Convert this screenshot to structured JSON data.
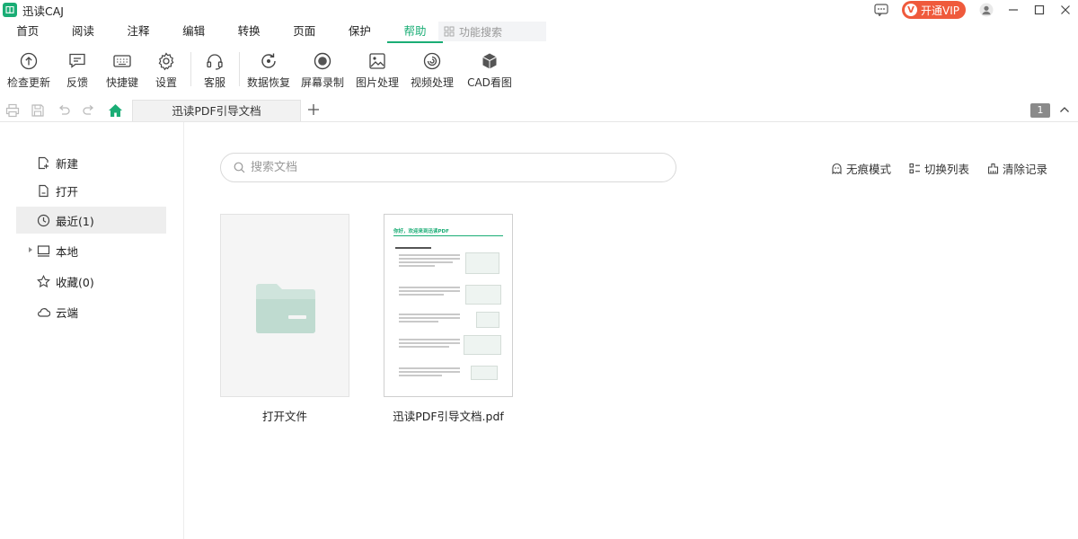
{
  "app": {
    "name": "迅读CAJ"
  },
  "titlebar": {
    "vip_label": "开通VIP",
    "vip_badge": "V"
  },
  "menu": {
    "tabs": [
      "首页",
      "阅读",
      "注释",
      "编辑",
      "转换",
      "页面",
      "保护",
      "帮助"
    ],
    "active_tab": "帮助",
    "search_placeholder": "功能搜索"
  },
  "ribbon": {
    "items": [
      "检查更新",
      "反馈",
      "快捷键",
      "设置",
      "客服",
      "数据恢复",
      "屏幕录制",
      "图片处理",
      "视频处理",
      "CAD看图"
    ]
  },
  "doc_tabs": {
    "current": "迅读PDF引导文档",
    "page_count": "1"
  },
  "sidebar": {
    "new": "新建",
    "open": "打开",
    "recent": "最近(1)",
    "local": "本地",
    "favorites": "收藏(0)",
    "cloud": "云端"
  },
  "main": {
    "search_placeholder": "搜索文档",
    "actions": {
      "incognito": "无痕模式",
      "switch_list": "切换列表",
      "clear_history": "清除记录"
    },
    "files": [
      {
        "label": "打开文件"
      },
      {
        "label": "迅读PDF引导文档.pdf",
        "preview_title": "你好，欢迎来到迅读PDF"
      }
    ]
  },
  "colors": {
    "accent": "#1aad75",
    "vip": "#ef5a3c",
    "folder": "#cfe4dc"
  }
}
